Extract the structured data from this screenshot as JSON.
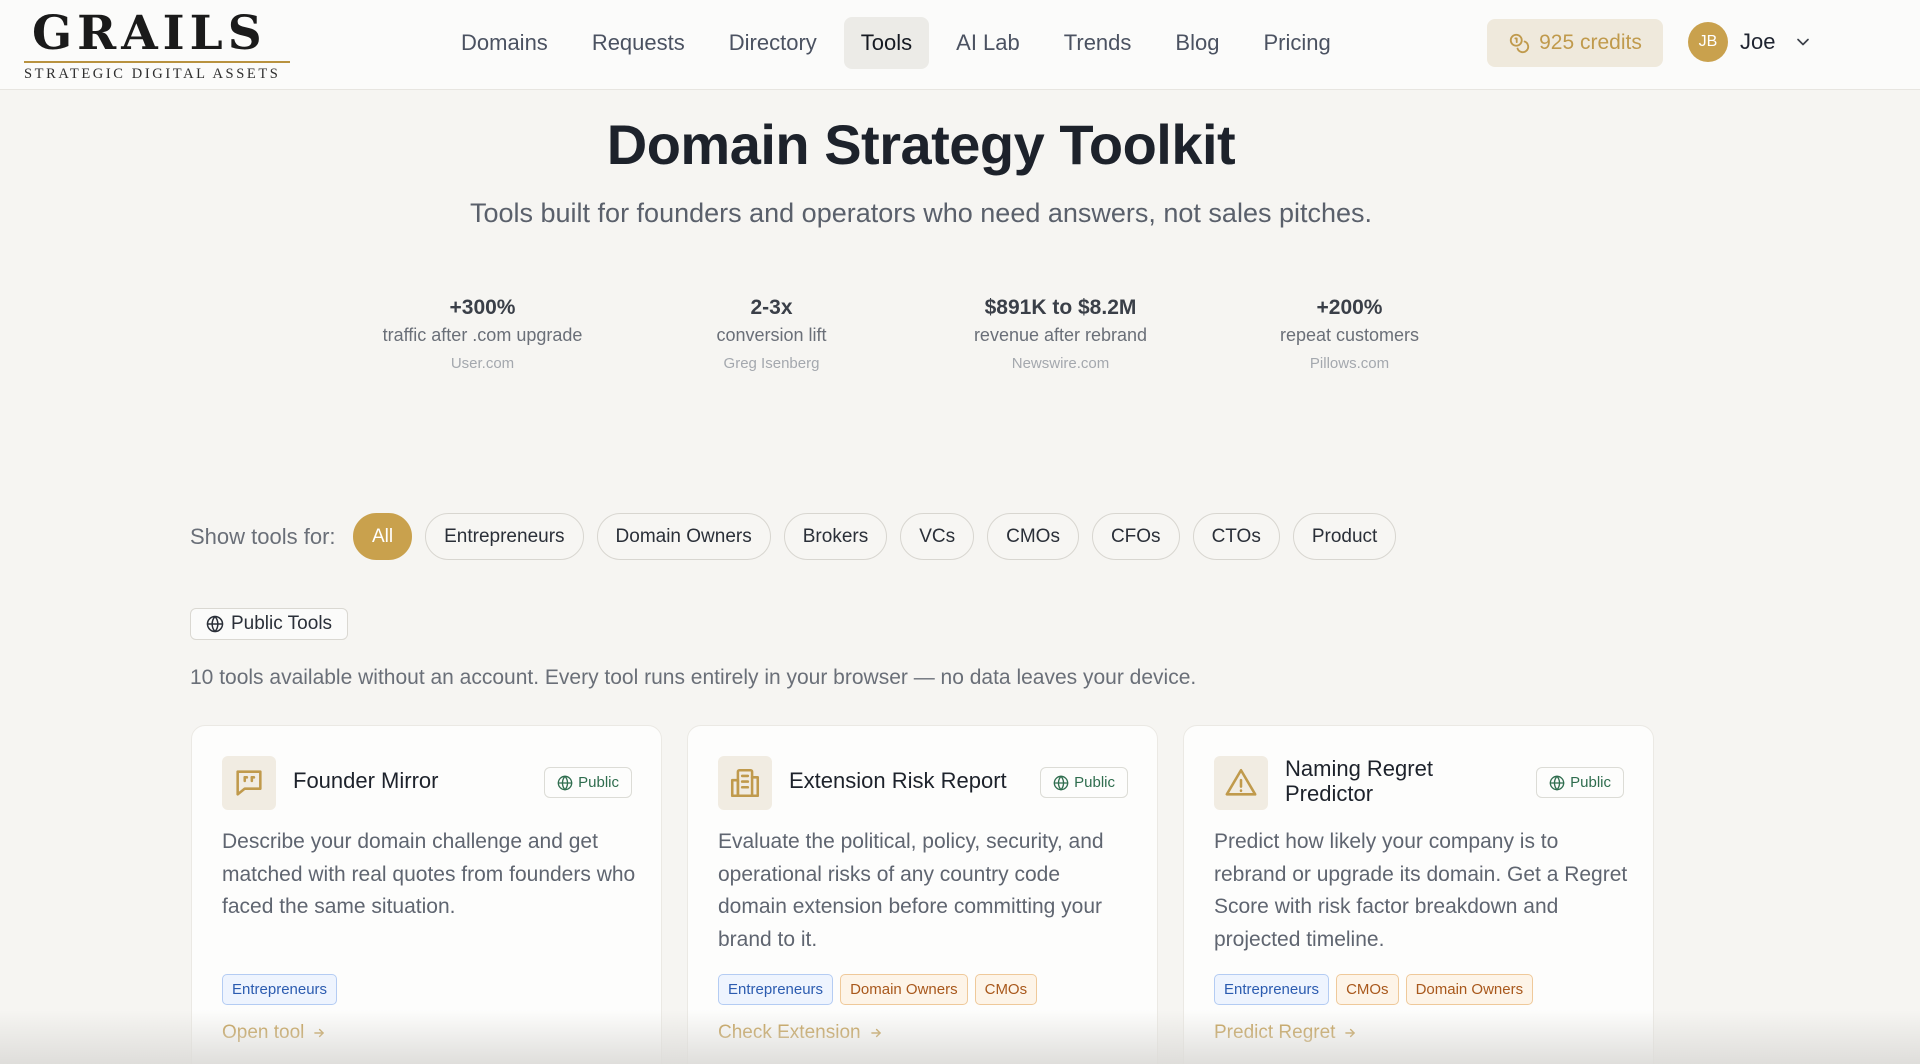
{
  "brand": {
    "name": "GRAILS",
    "tagline": "STRATEGIC DIGITAL ASSETS",
    "accent": "#c9a14d"
  },
  "nav": {
    "items": [
      {
        "label": "Domains",
        "active": false
      },
      {
        "label": "Requests",
        "active": false
      },
      {
        "label": "Directory",
        "active": false
      },
      {
        "label": "Tools",
        "active": true
      },
      {
        "label": "AI Lab",
        "active": false
      },
      {
        "label": "Trends",
        "active": false
      },
      {
        "label": "Blog",
        "active": false
      },
      {
        "label": "Pricing",
        "active": false
      }
    ],
    "credits_label": "925 credits",
    "credits_icon": "coins-icon"
  },
  "user": {
    "initials": "JB",
    "name": "Joe",
    "menu_icon": "chevron-down-icon"
  },
  "hero": {
    "title": "Domain Strategy Toolkit",
    "subtitle": "Tools built for founders and operators who need answers, not sales pitches."
  },
  "stats": [
    {
      "value": "+300%",
      "label": "traffic after .com upgrade",
      "source": "User.com"
    },
    {
      "value": "2-3x",
      "label": "conversion lift",
      "source": "Greg Isenberg"
    },
    {
      "value": "$891K to $8.2M",
      "label": "revenue after rebrand",
      "source": "Newswire.com"
    },
    {
      "value": "+200%",
      "label": "repeat customers",
      "source": "Pillows.com"
    }
  ],
  "filters": {
    "label": "Show tools for:",
    "options": [
      "All",
      "Entrepreneurs",
      "Domain Owners",
      "Brokers",
      "VCs",
      "CMOs",
      "CFOs",
      "CTOs",
      "Product"
    ],
    "selected": "All"
  },
  "section": {
    "badge": "Public Tools",
    "badge_icon": "globe-icon",
    "description": "10 tools available without an account. Every tool runs entirely in your browser — no data leaves your device."
  },
  "cards": [
    {
      "icon": "quote-bubble-icon",
      "title": "Founder Mirror",
      "badge": "Public",
      "description": "Describe your domain challenge and get matched with real quotes from founders who faced the same situation.",
      "tags": [
        {
          "label": "Entrepreneurs",
          "color": "blue"
        }
      ],
      "cta": "Open tool"
    },
    {
      "icon": "building-icon",
      "title": "Extension Risk Report",
      "badge": "Public",
      "description": "Evaluate the political, policy, security, and operational risks of any country code domain extension before committing your brand to it.",
      "tags": [
        {
          "label": "Entrepreneurs",
          "color": "blue"
        },
        {
          "label": "Domain Owners",
          "color": "amber"
        },
        {
          "label": "CMOs",
          "color": "amber"
        }
      ],
      "cta": "Check Extension"
    },
    {
      "icon": "warning-triangle-icon",
      "title": "Naming Regret Predictor",
      "badge": "Public",
      "description": "Predict how likely your company is to rebrand or upgrade its domain. Get a Regret Score with risk factor breakdown and projected timeline.",
      "tags": [
        {
          "label": "Entrepreneurs",
          "color": "blue"
        },
        {
          "label": "CMOs",
          "color": "amber"
        },
        {
          "label": "Domain Owners",
          "color": "amber"
        }
      ],
      "cta": "Predict Regret"
    }
  ]
}
